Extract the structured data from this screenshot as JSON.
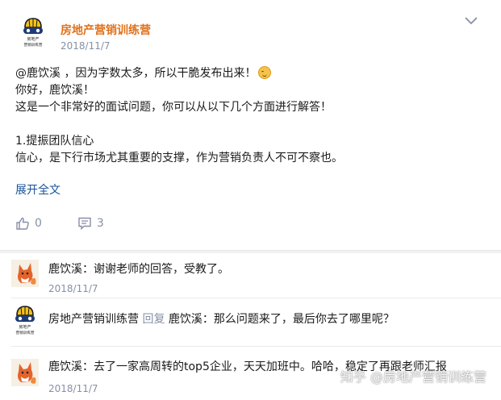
{
  "post": {
    "author": "房地产营销训练营",
    "date": "2018/11/7",
    "avatar_lines": [
      "房地产",
      "营销训练营"
    ],
    "lines": [
      "@鹿饮溪 ，因为字数太多，所以干脆发布出来！",
      "你好，鹿饮溪！",
      "这是一个非常好的面试问题，你可以从以下几个方面进行解答！",
      "",
      "1.提振团队信心",
      "信心，是下行市场尤其重要的支撑，作为营销负责人不可不察也。"
    ],
    "expand_label": "展开全文",
    "likes": "0",
    "comments": "3"
  },
  "replies": [
    {
      "author": "鹿饮溪",
      "text": "：谢谢老师的回答，受教了。",
      "date": "2018/11/7"
    },
    {
      "author": "房地产营销训练营",
      "reply_word": "回复",
      "target": "鹿饮溪",
      "text": "：那么问题来了，最后你去了哪里呢？",
      "avatar_lines": [
        "房地产",
        "营销训练营"
      ]
    },
    {
      "author": "鹿饮溪",
      "text": "：去了一家高周转的top5企业，天天加班中。哈哈，稳定了再跟老师汇报",
      "date": "2018/11/7"
    }
  ],
  "watermark": "知乎 @房地产营销训练营",
  "colors": {
    "author": "#e0701a",
    "link": "#175199",
    "meta": "#8590a6"
  },
  "icons": [
    "chevron-down-icon",
    "thumbs-up-icon",
    "comment-icon"
  ]
}
